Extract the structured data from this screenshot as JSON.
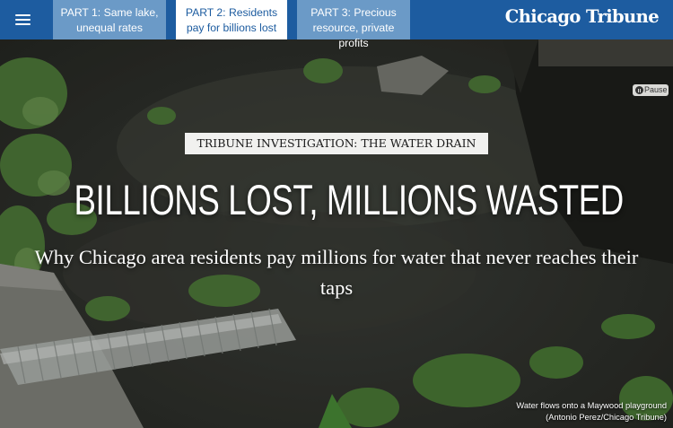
{
  "nav": {
    "tabs": [
      {
        "label": "PART 1: Same lake, unequal rates",
        "active": false
      },
      {
        "label": "PART 2: Residents pay for billions lost",
        "active": true
      },
      {
        "label": "PART 3: Precious resource, private profits",
        "active": false
      }
    ],
    "logo": "Chicago Tribune",
    "menu_icon": "hamburger-menu-icon"
  },
  "hero": {
    "pause_label": "Pause",
    "kicker": "TRIBUNE INVESTIGATION: THE WATER DRAIN",
    "headline": "BILLIONS LOST, MILLIONS WASTED",
    "dek": "Why Chicago area residents pay millions for water that never reaches their taps",
    "caption_line1": "Water flows onto a Maywood playground",
    "caption_line2": "(Antonio Perez/Chicago Tribune)"
  },
  "colors": {
    "nav_bg": "#1d5ca0",
    "tab_bg": "#6b9ac7",
    "tab_active_bg": "#ffffff"
  }
}
